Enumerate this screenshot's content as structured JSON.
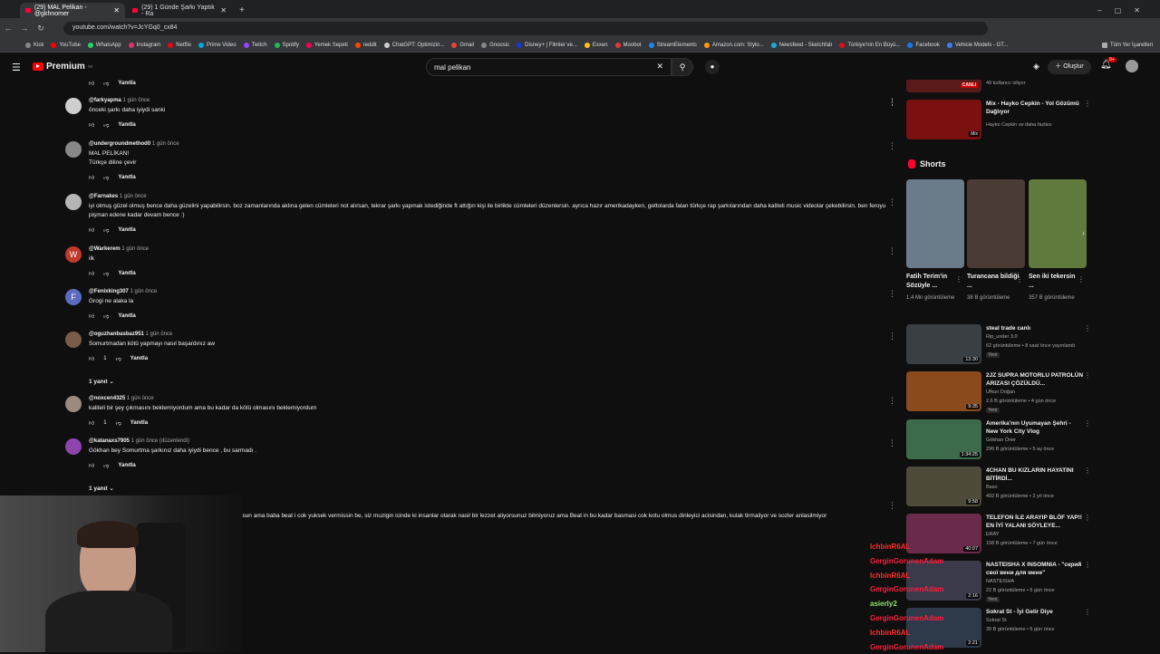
{
  "browser": {
    "tabs": [
      {
        "label": "(29) MAL Pelikan - @gkhnomer"
      },
      {
        "label": "(29) 1 Günde Şarkı Yaptık - Ra"
      }
    ],
    "url": "youtube.com/watch?v=JcYGq0_cx84",
    "bookmarks": [
      "Kick",
      "YouTube",
      "WhatsApp",
      "Instagram",
      "Netflix",
      "Prime Video",
      "Twitch",
      "Spotify",
      "Yemek Sepeti",
      "reddit",
      "ChatGPT: Optimizin...",
      "Gmail",
      "Gnoosic",
      "Disney+ | Filmler ve...",
      "Exxen",
      "Moobot",
      "StreamElements",
      "Amazon.com: Stylo...",
      "Newsfeed - Sketchfab",
      "Türkiye'nin En Büyü...",
      "Facebook",
      "Vehicle Models - GT..."
    ],
    "bookmarks_right": "Tüm Yer İşaretleri"
  },
  "youtube": {
    "logo": "Premium",
    "logo_sup": "TR",
    "search_value": "mal pelikan",
    "create_label": "Oluştur",
    "notif_count": "9+"
  },
  "top_reply": "Yanıtla",
  "comments": [
    {
      "avatar": "",
      "user": "@farkyapma",
      "time": "1 gün önce",
      "text": "önceki şarkı daha iyiydi sanki",
      "likes": "",
      "reply": "Yanıtla",
      "avatar_color": "#cfcfcf"
    },
    {
      "avatar": "",
      "user": "@undergroundmethod0",
      "time": "1 gün önce",
      "text": "MAL PELİKAN!\nTürkçe diline çevir",
      "likes": "",
      "reply": "Yanıtla",
      "avatar_color": "#888"
    },
    {
      "avatar": "",
      "user": "@Farnakes",
      "time": "1 gün önce",
      "text": "iyi olmuş güzel olmuş bence daha güzelini yapabilirsin. boz zamanlarında aklına gelen cümleleri not alırsan, tekrar şarkı yapmak istediğinde ft attığın kişi ile birlikte cümleleri düzenlersin. ayrıca hazır amerikadayken, gettolarda falan türkçe rap şarkılarından daha kaliteli music videolar çekebilirsin. ben feroyu pişman edene kadar devam bence :)",
      "likes": "",
      "reply": "Yanıtla",
      "avatar_color": "#b5b5b5"
    },
    {
      "avatar": "W",
      "user": "@Warkerem",
      "time": "1 gün önce",
      "text": "ilk",
      "likes": "",
      "reply": "Yanıtla",
      "avatar_color": "#c0392b"
    },
    {
      "avatar": "F",
      "user": "@Fenixking307",
      "time": "1 gün önce",
      "text": "Grogi ne alaka la",
      "likes": "",
      "reply": "Yanıtla",
      "avatar_color": "#5c6bc0"
    },
    {
      "avatar": "",
      "user": "@oguzhanbasbaz951",
      "time": "1 gün önce",
      "text": "Somurtmadan kötü yapmayı nasıl başardınız aw",
      "likes": "1",
      "reply": "Yanıtla",
      "avatar_color": "#7a5c4a",
      "replies": "1 yanıt"
    },
    {
      "avatar": "",
      "user": "@noxcen4325",
      "time": "1 gün önce",
      "text": "kaliteli bir şey çıkmasını beklemiyordum ama bu kadar da kötü olmasını beklemiyordum",
      "likes": "1",
      "reply": "Yanıtla",
      "avatar_color": "#9a8a80"
    },
    {
      "avatar": "",
      "user": "@katanaxs7905",
      "time": "1 gün önce (düzenlendi)",
      "text": "Gökhan bey Somurtma şarkınız daha iyiydi bence , bu sarmadı .",
      "likes": "",
      "reply": "Yanıtla",
      "avatar_color": "#8e44ad",
      "replies": "1 yanıt"
    }
  ],
  "partial_comment": "isun ama baba beat i cok yuksek vermissin be, siz muzigin icinde ki insanlar olarak nasil bir lezzet aliyorsunuz bilmiyoruz ama Beat in bu kadar basmasi cok kotu olmus dinleyici acisindan, kulak tirmaliyor ve sozler anlasilmiyor",
  "sidebar": {
    "live_viewers": "49 kullanıcı izliyor",
    "live_badge": "CANLI",
    "mix": {
      "title": "Mix - Hayko Cepkin - Yol Gözümü Dağlıyor",
      "meta": "Hayko Cepkin ve daha fazlası",
      "badge": "Mix"
    },
    "shorts_title": "Shorts",
    "shorts": [
      {
        "title": "Fatih Terim'in Sözüyle ...",
        "views": "1,4 Mn görüntüleme",
        "color": "#6b7b8a"
      },
      {
        "title": "Turancana bildiği ...",
        "views": "38 B görüntüleme",
        "color": "#4a3b35"
      },
      {
        "title": "Sen iki tekersin ...",
        "views": "357 B görüntüleme",
        "color": "#5f7a3c"
      }
    ],
    "videos": [
      {
        "title": "steal trade canlı",
        "channel": "Rip_under 3.0",
        "meta": "62 görüntüleme • 8 saat önce yayınlandı",
        "badge": "Yeni",
        "duration": "13:30",
        "color": "#3a3f44"
      },
      {
        "title": "2JZ SUPRA MOTORLU PATROLÜN ARIZASI ÇÖZÜLDÜ...",
        "channel": "Ufkun Doğan",
        "meta": "2,6 B görüntüleme • 4 gün önce",
        "badge": "Yeni",
        "duration": "9:35",
        "color": "#8a4a1c"
      },
      {
        "title": "Amerika'nın Uyumayan Şehri - New York City Vlog",
        "channel": "Gökhan Öner",
        "meta": "296 B görüntüleme • 5 ay önce",
        "badge": "",
        "duration": "1:34:25",
        "color": "#3c6a4a"
      },
      {
        "title": "4CHAN BU KIZLARIN HAYATINI BİTİRDİ...",
        "channel": "Baso",
        "meta": "492 B görüntüleme • 2 yıl önce",
        "badge": "",
        "duration": "9:58",
        "color": "#4d4a3a"
      },
      {
        "title": "TELEFON İLE ARAYIP BLÖF YAP!! EN İYİ YALANI SÖYLEYE...",
        "channel": "ERAY",
        "meta": "158 B görüntüleme • 7 gün önce",
        "badge": "",
        "duration": "40:07",
        "color": "#6a2a4a"
      },
      {
        "title": "NASTEISHA X INSOMNIA - \"скрий свої вени для мене\"",
        "channel": "NASTEISHA",
        "meta": "22 B görüntüleme • 6 gün önce",
        "badge": "Yeni",
        "duration": "2:16",
        "color": "#3a3a4a"
      },
      {
        "title": "Sokrat St - İyi Gelir Diye",
        "channel": "Sokrat St",
        "meta": "30 B görüntüleme • 5 gün önce",
        "badge": "",
        "duration": "2:21",
        "color": "#2e3a4a"
      }
    ]
  },
  "stream_chat": [
    {
      "user": "IchbinR6AL",
      "color": "#ff2d2d"
    },
    {
      "user": "GerginGorunenAdam",
      "color": "#ff1f3d"
    },
    {
      "user": "IchbinR6AL",
      "color": "#ff2d2d"
    },
    {
      "user": "GerginGorunenAdam",
      "color": "#ff1f3d"
    },
    {
      "user": "asierly2",
      "color": "#8fe36a"
    },
    {
      "user": "GerginGorunenAdam",
      "color": "#ff1f3d"
    },
    {
      "user": "IchbinR6AL",
      "color": "#ff2d2d"
    },
    {
      "user": "GerginGorunenAdam",
      "color": "#ff1f3d"
    }
  ]
}
